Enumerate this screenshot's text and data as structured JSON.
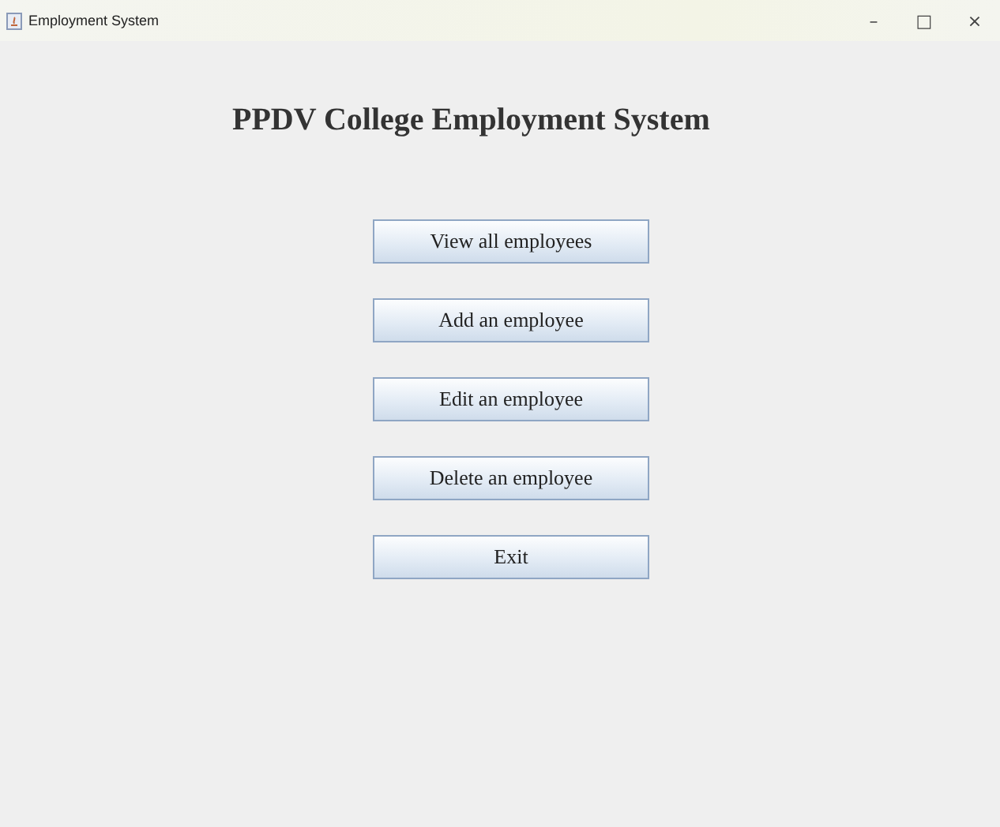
{
  "window": {
    "title": "Employment System",
    "controls": [
      "–",
      "□",
      "×"
    ]
  },
  "heading": "PPDV College Employment System",
  "buttons": [
    "View all employees",
    "Add an employee",
    "Edit an employee",
    "Delete an employee",
    "Exit"
  ]
}
